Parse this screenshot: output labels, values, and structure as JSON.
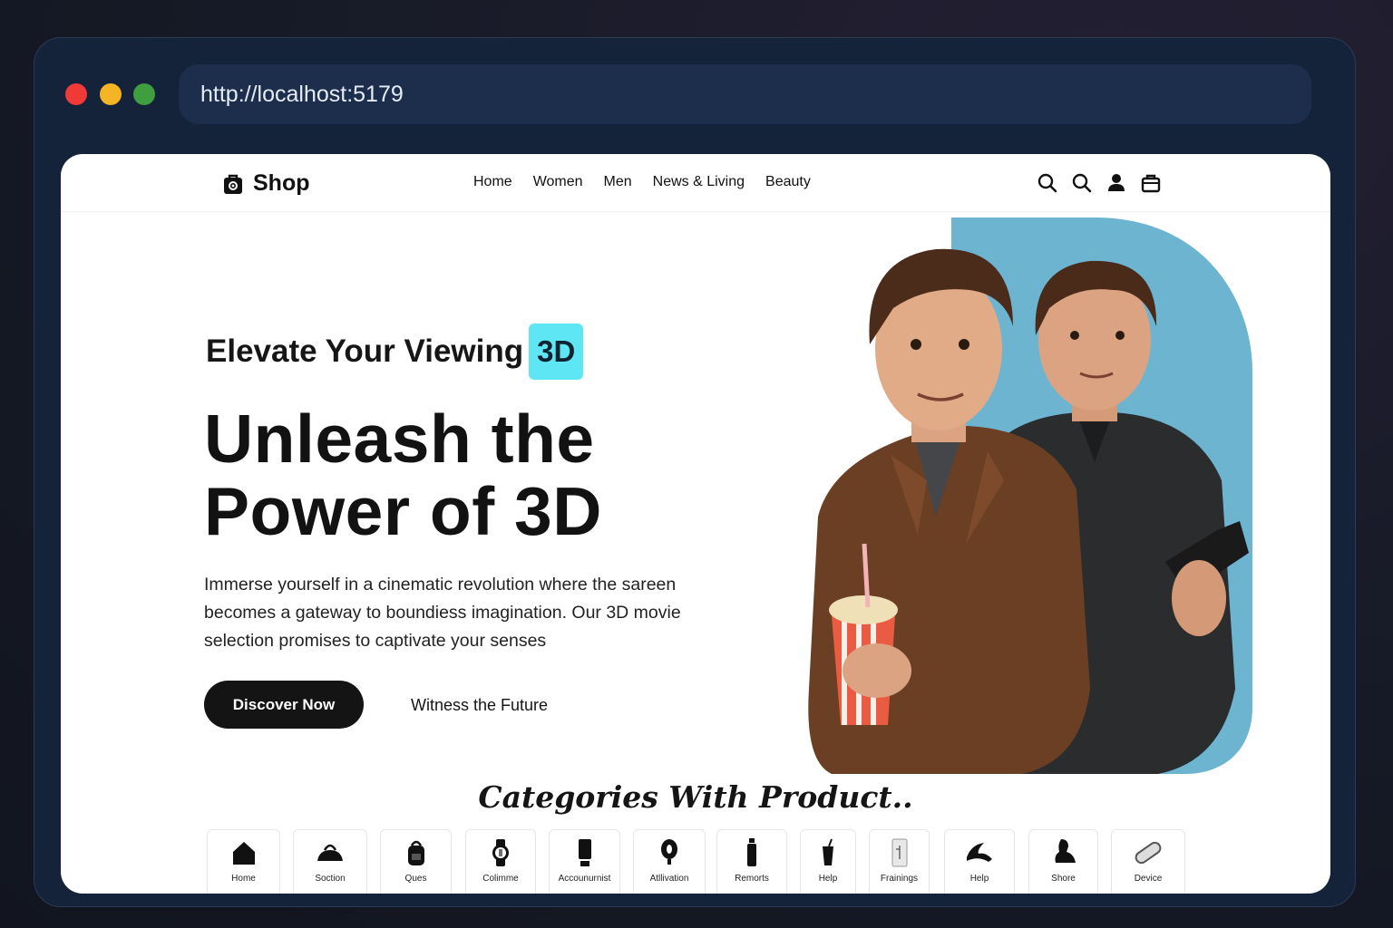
{
  "browser": {
    "url": "http://localhost:5179"
  },
  "nav": {
    "brand": "Shop",
    "links": [
      "Home",
      "Women",
      "Men",
      "News & Living",
      "Beauty"
    ],
    "icons": [
      "search-icon",
      "search-icon",
      "user-icon",
      "bag-icon"
    ]
  },
  "hero": {
    "kicker": "Elevate Your Viewing",
    "badge": "3D",
    "headline_line1": "Unleash the",
    "headline_line2": "Power of 3D",
    "description": "Immerse yourself in a cinematic revolution where the sareen becomes a gateway to boundiess imagination. Our 3D movie selection promises to captivate your senses",
    "primary_cta": "Discover Now",
    "secondary_cta": "Witness the Future"
  },
  "categories": {
    "title": "Categories With Product..",
    "items": [
      {
        "label": "Home",
        "icon": "house-icon"
      },
      {
        "label": "Soction",
        "icon": "handbag-icon"
      },
      {
        "label": "Ques",
        "icon": "backpack-icon"
      },
      {
        "label": "Colimme",
        "icon": "watch-icon"
      },
      {
        "label": "Accounurnist",
        "icon": "phone-icon"
      },
      {
        "label": "Atllivation",
        "icon": "lamp-icon"
      },
      {
        "label": "Remorts",
        "icon": "bottle-icon"
      },
      {
        "label": "Help",
        "icon": "cup-icon"
      },
      {
        "label": "Frainings",
        "icon": "fridge-icon"
      },
      {
        "label": "Help",
        "icon": "shoe-icon"
      },
      {
        "label": "Shore",
        "icon": "boot-icon"
      },
      {
        "label": "Device",
        "icon": "pill-icon"
      }
    ]
  },
  "colors": {
    "badge": "#5ee6f5",
    "art_panel": "#6cb4d0",
    "jacket": "#6b3f24",
    "primary_button": "#141414"
  }
}
